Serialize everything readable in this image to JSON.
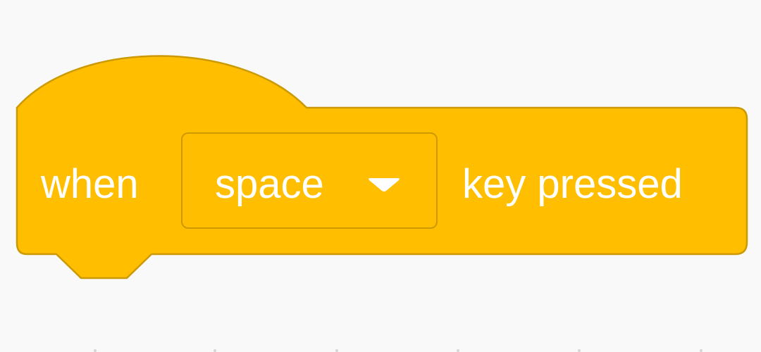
{
  "block": {
    "category": "events",
    "color": "#ffbf00",
    "border_color": "#cc9900",
    "text_color": "#ffffff",
    "label_before": "when",
    "label_after": "key pressed",
    "key_dropdown": {
      "selected": "space",
      "icon": "caret-down-icon"
    }
  }
}
